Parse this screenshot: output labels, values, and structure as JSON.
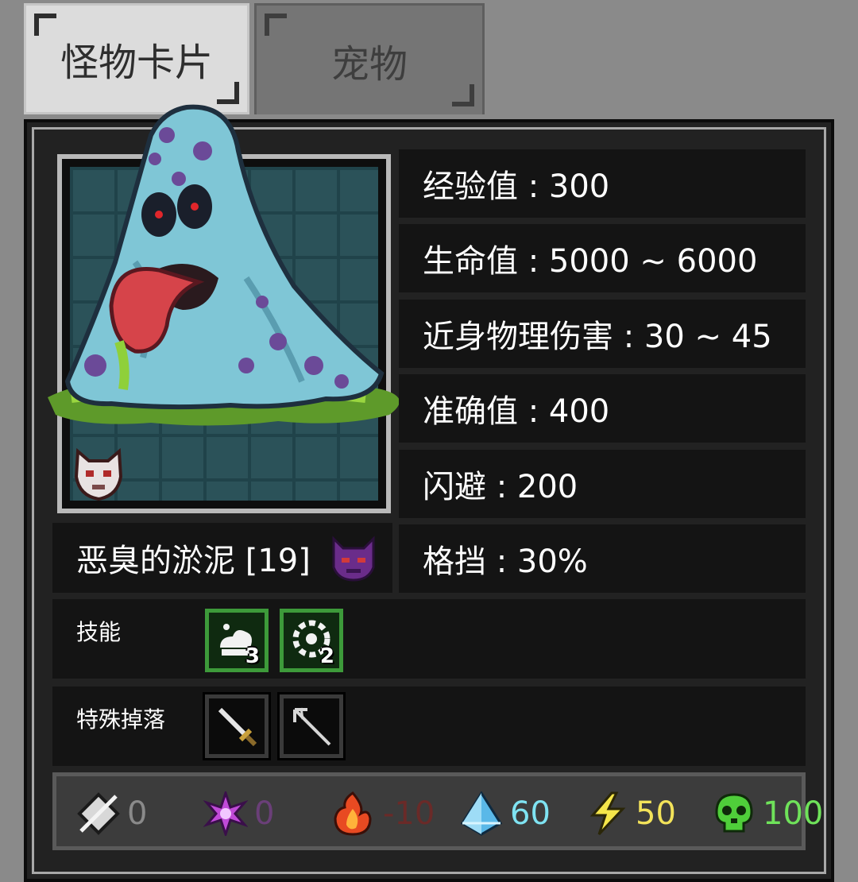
{
  "tabs": [
    {
      "label": "怪物卡片",
      "active": true
    },
    {
      "label": "宠物",
      "active": false
    }
  ],
  "monster": {
    "name": "恶臭的淤泥 [19]",
    "rank_icon": "demon-rank-icon",
    "type_icon": "mask-icon"
  },
  "stats": [
    {
      "label": "经验值 : 300"
    },
    {
      "label": "生命值 : 5000 ~ 6000"
    },
    {
      "label": "近身物理伤害 : 30 ~ 45"
    },
    {
      "label": "准确值 : 400"
    },
    {
      "label": "闪避 : 200"
    },
    {
      "label": "格挡 : 30%"
    }
  ],
  "skills": {
    "label": "技能",
    "items": [
      {
        "icon": "slime-burst-icon",
        "count": "3"
      },
      {
        "icon": "slime-ring-icon",
        "count": "2"
      }
    ]
  },
  "drops": {
    "label": "特殊掉落",
    "items": [
      {
        "icon": "sword-icon"
      },
      {
        "icon": "trident-icon"
      }
    ]
  },
  "resistances": [
    {
      "icon": "physical-resist-icon",
      "value": "0",
      "color": "#8a8a8a"
    },
    {
      "icon": "arcane-resist-icon",
      "value": "0",
      "color": "#6a3f78"
    },
    {
      "icon": "fire-resist-icon",
      "value": "-10",
      "color": "#6a2a28"
    },
    {
      "icon": "ice-resist-icon",
      "value": "60",
      "color": "#7fe3f2"
    },
    {
      "icon": "lightning-resist-icon",
      "value": "50",
      "color": "#f3e35a"
    },
    {
      "icon": "poison-resist-icon",
      "value": "100",
      "color": "#6fe25a"
    }
  ]
}
